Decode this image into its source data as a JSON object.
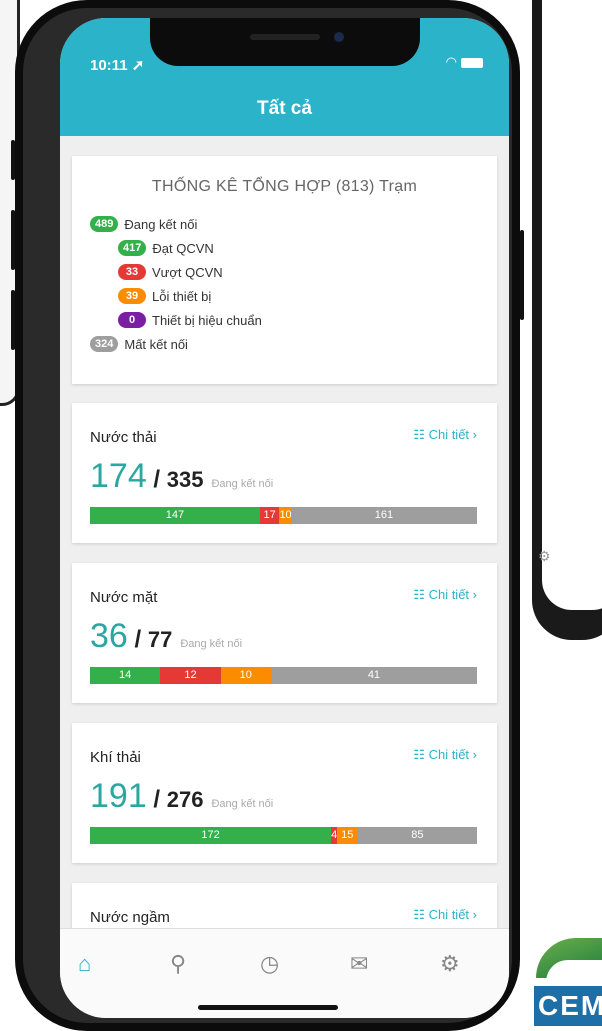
{
  "status_time": "10:11",
  "header": {
    "title": "Tất cả"
  },
  "summary": {
    "title": "THỐNG KÊ TỔNG HỢP",
    "total": "(813)",
    "unit": "Trạm",
    "rows": [
      {
        "count": "489",
        "label": "Đang kết nối",
        "color": "#34b04a"
      },
      {
        "count": "417",
        "label": "Đạt QCVN",
        "color": "#34b04a"
      },
      {
        "count": "33",
        "label": "Vượt QCVN",
        "color": "#e53935"
      },
      {
        "count": "39",
        "label": "Lỗi thiết bị",
        "color": "#fb8c00"
      },
      {
        "count": "0",
        "label": "Thiết bị hiệu chuẩn",
        "color": "#7b1fa2"
      },
      {
        "count": "324",
        "label": "Mất kết nối",
        "color": "#9e9e9e"
      }
    ]
  },
  "detail_label": "Chi tiết",
  "connected_label": "Đang kết nối",
  "categories": [
    {
      "name": "Nước thải",
      "connected": "174",
      "slash": "/",
      "total": "335",
      "bar": [
        {
          "value": 147,
          "label": "147",
          "color": "#34b04a"
        },
        {
          "value": 17,
          "label": "17",
          "color": "#e53935"
        },
        {
          "value": 10,
          "label": "10",
          "color": "#fb8c00"
        },
        {
          "value": 161,
          "label": "161",
          "color": "#9e9e9e"
        }
      ]
    },
    {
      "name": "Nước mặt",
      "connected": "36",
      "slash": "/",
      "total": "77",
      "bar": [
        {
          "value": 14,
          "label": "14",
          "color": "#34b04a"
        },
        {
          "value": 12,
          "label": "12",
          "color": "#e53935"
        },
        {
          "value": 10,
          "label": "10",
          "color": "#fb8c00"
        },
        {
          "value": 41,
          "label": "41",
          "color": "#9e9e9e"
        }
      ]
    },
    {
      "name": "Khí thải",
      "connected": "191",
      "slash": "/",
      "total": "276",
      "bar": [
        {
          "value": 172,
          "label": "172",
          "color": "#34b04a"
        },
        {
          "value": 4,
          "label": "4",
          "color": "#e53935"
        },
        {
          "value": 15,
          "label": "15",
          "color": "#fb8c00"
        },
        {
          "value": 85,
          "label": "85",
          "color": "#9e9e9e"
        }
      ]
    },
    {
      "name": "Nước ngầm"
    }
  ],
  "tabs": [
    {
      "name": "home-icon",
      "active": true
    },
    {
      "name": "map-pin-icon",
      "active": false
    },
    {
      "name": "clock-icon",
      "active": false
    },
    {
      "name": "mail-icon",
      "active": false
    },
    {
      "name": "gear-icon",
      "active": false
    }
  ],
  "logo_text": "CEM",
  "colors": {
    "accent": "#2bb3c9",
    "count": "#2aa7a0"
  }
}
